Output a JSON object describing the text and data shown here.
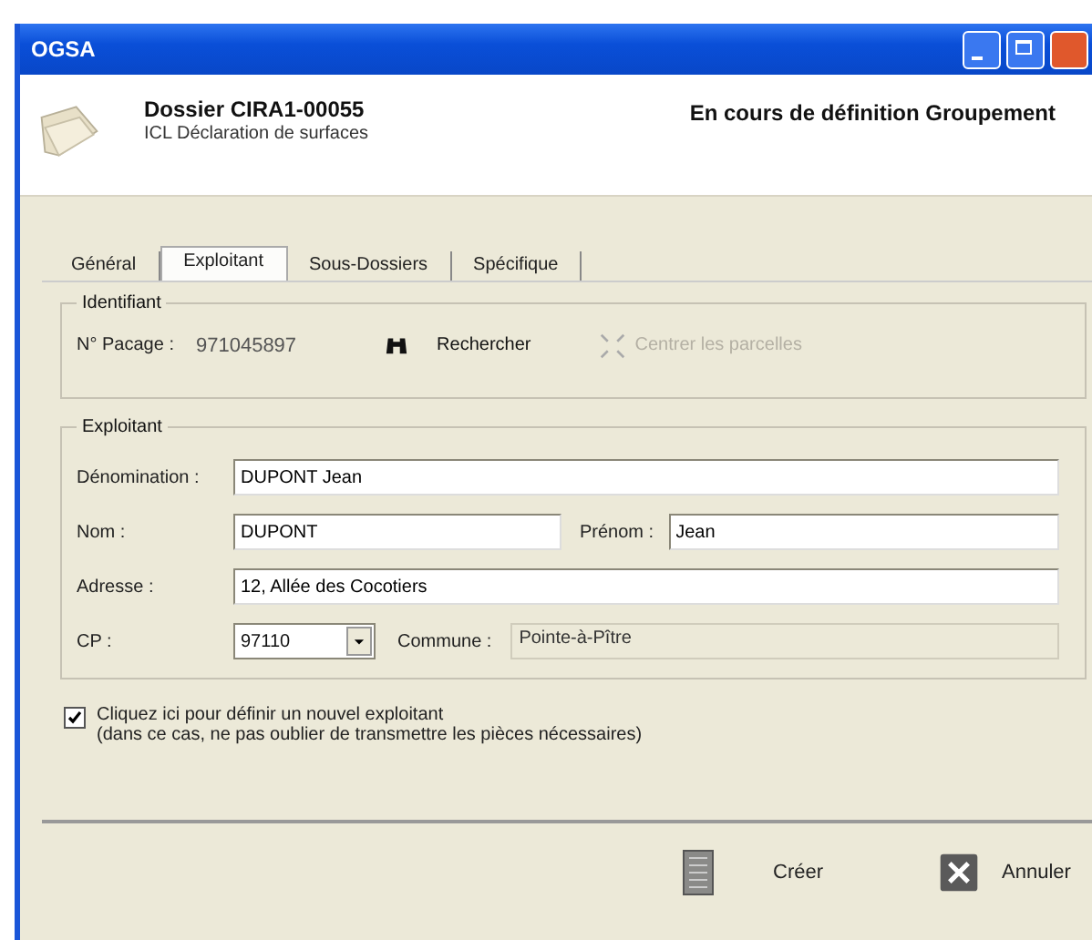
{
  "window": {
    "title": "OGSA"
  },
  "header": {
    "title": "Dossier CIRA1-00055",
    "subtitle": "ICL Déclaration de surfaces",
    "status": "En cours de définition Groupement"
  },
  "tabs": [
    {
      "label": "Général",
      "selected": false
    },
    {
      "label": "Exploitant",
      "selected": true
    },
    {
      "label": "Sous-Dossiers",
      "selected": false
    },
    {
      "label": "Spécifique",
      "selected": false
    }
  ],
  "identifiant": {
    "legend": "Identifiant",
    "pacage_label": "N° Pacage :",
    "pacage_value": "971045897",
    "search_button": {
      "label": "Rechercher",
      "disabled": false
    },
    "center_button": {
      "label": "Centrer les parcelles",
      "disabled": true
    }
  },
  "exploitant": {
    "legend": "Exploitant",
    "denomination": {
      "label": "Dénomination :",
      "value": "DUPONT Jean"
    },
    "nom": {
      "label": "Nom :",
      "value": "DUPONT"
    },
    "prenom": {
      "label": "Prénom :",
      "value": "Jean"
    },
    "adresse": {
      "label": "Adresse :",
      "value": "12, Allée des Cocotiers"
    },
    "cp": {
      "label": "CP :",
      "value": "97110"
    },
    "commune": {
      "label": "Commune :",
      "value": "Pointe-à-Pître"
    }
  },
  "new_exploitant": {
    "checked": true,
    "label": "Cliquez ici pour définir un nouvel exploitant",
    "note": "(dans ce cas, ne pas oublier de transmettre les pièces nécessaires)"
  },
  "buttons": [
    {
      "kind": "create",
      "label": "Créer"
    },
    {
      "kind": "cancel",
      "label": "Annuler"
    }
  ]
}
